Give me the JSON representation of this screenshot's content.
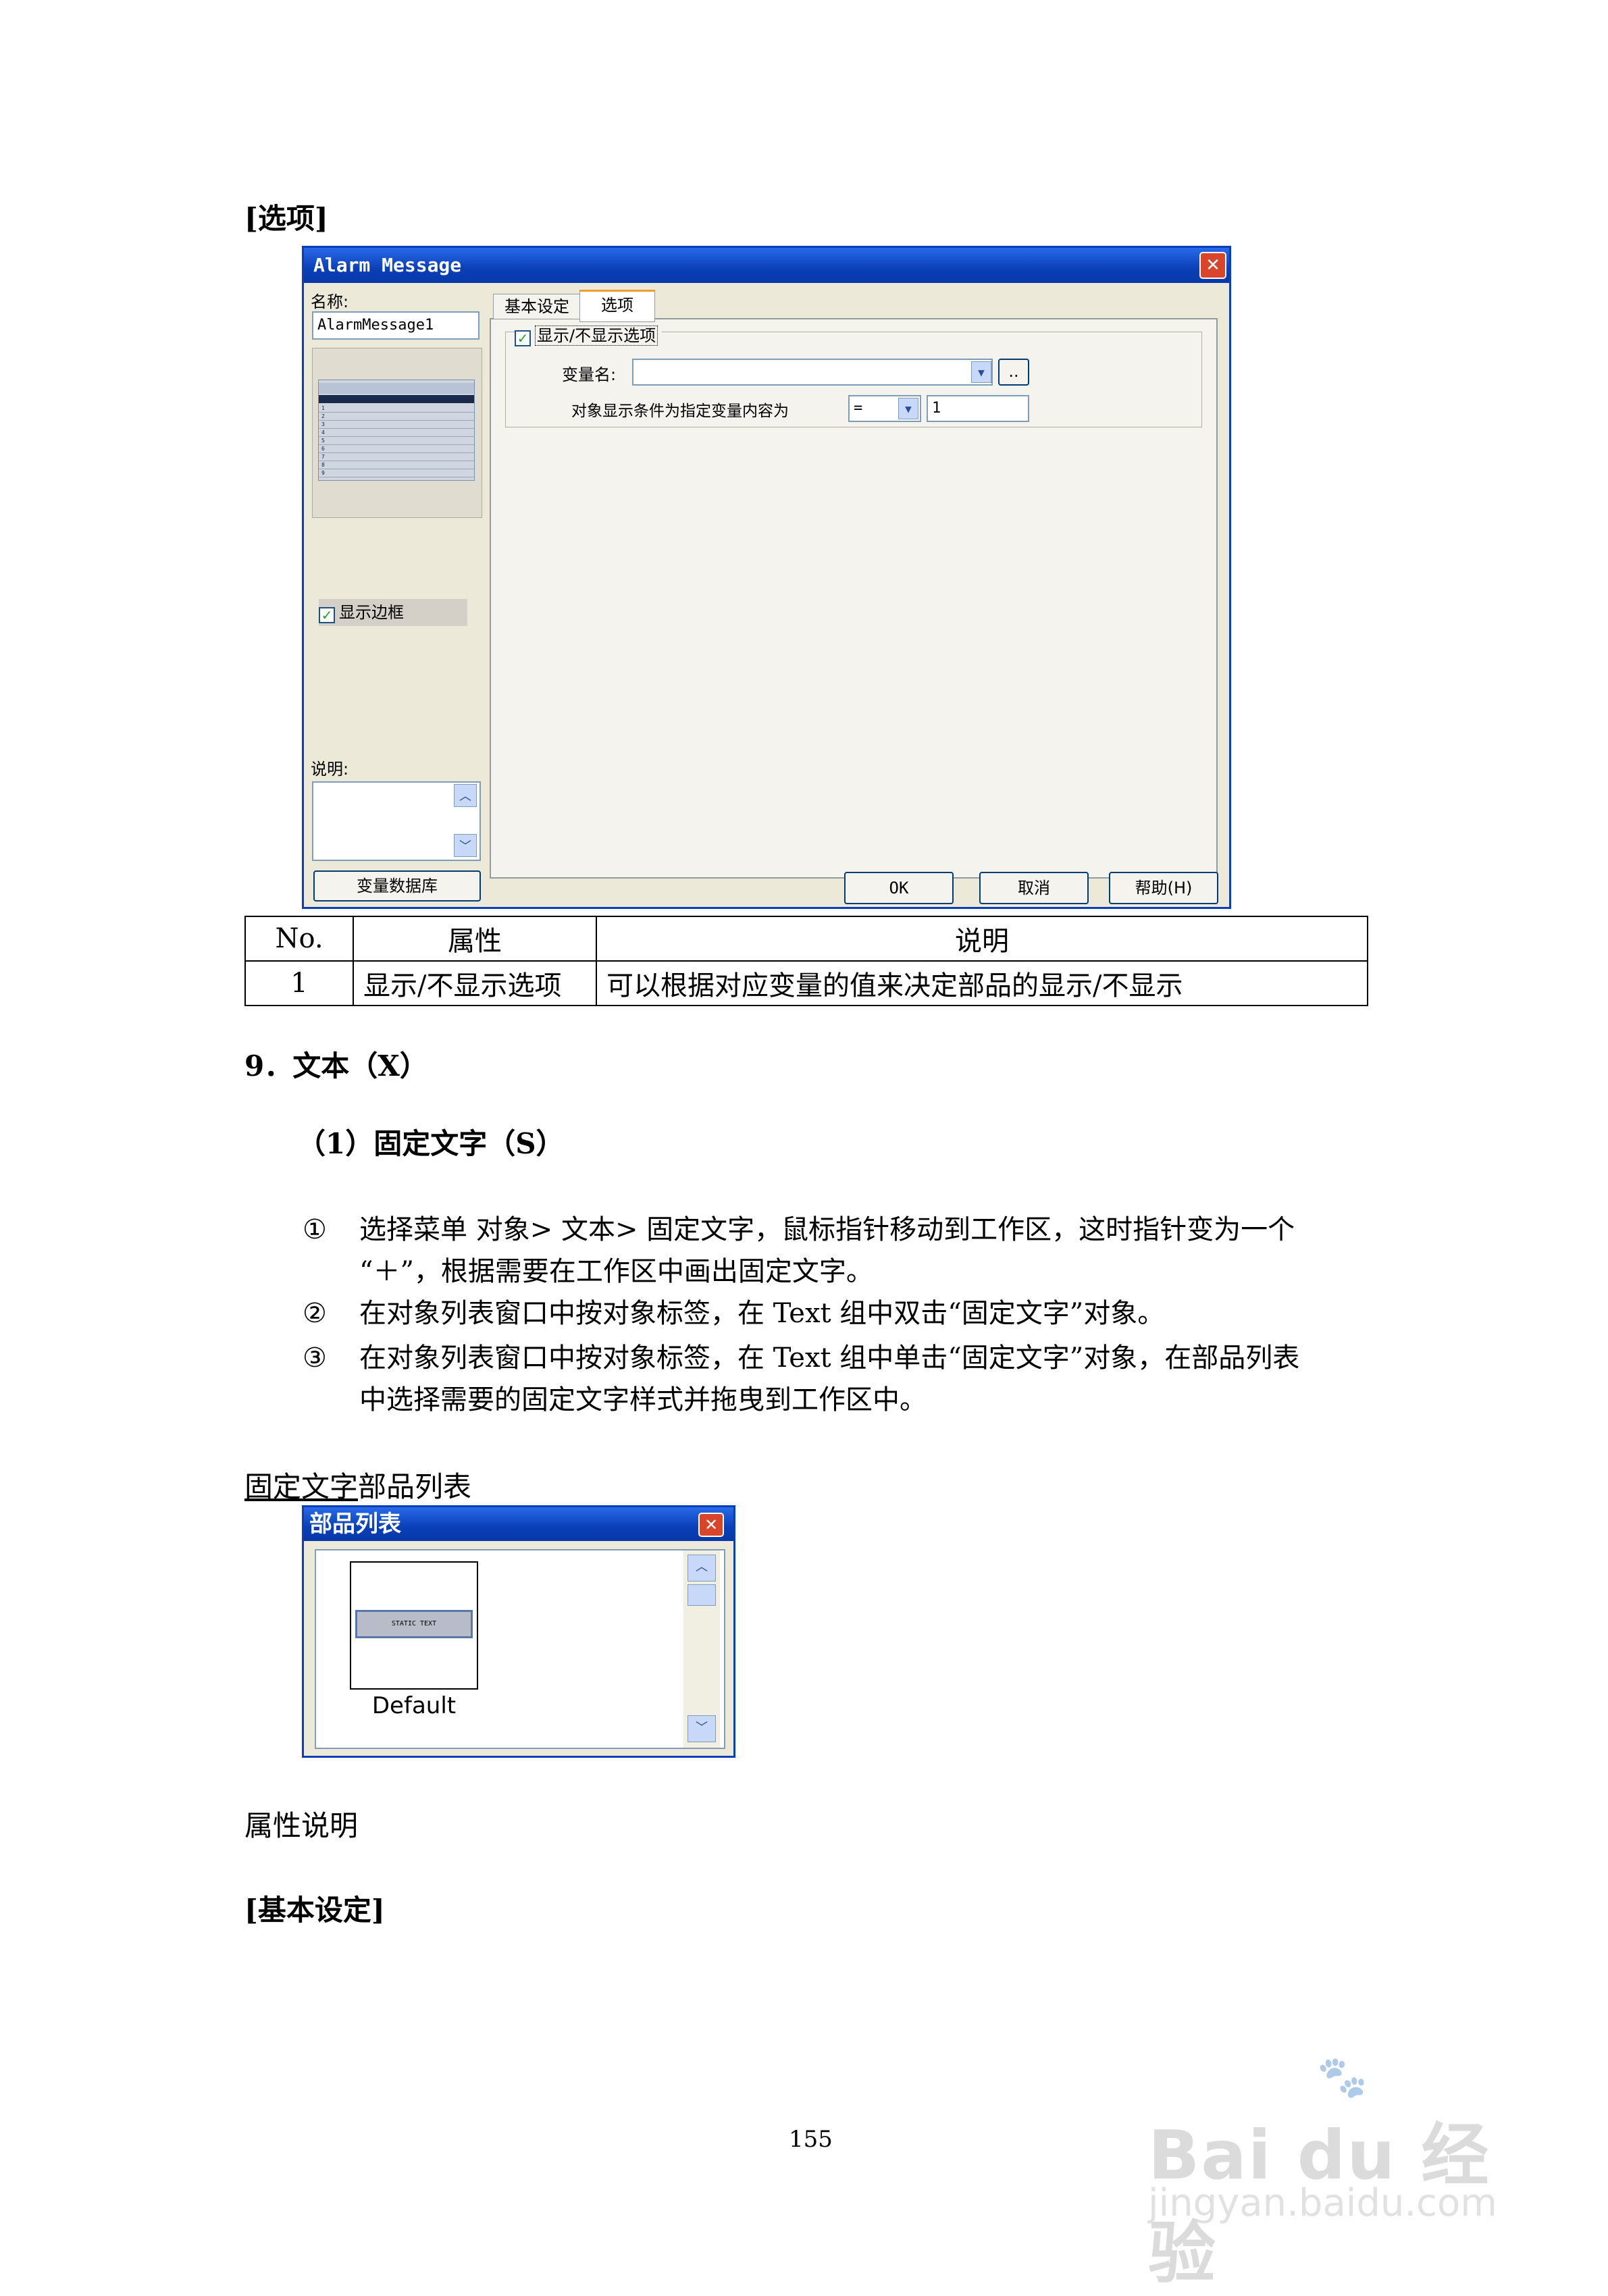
{
  "sections": {
    "options_heading": "[选项]",
    "text_heading": "9．文本（X）",
    "fixed_text_heading": "（1）固定文字（S）",
    "parts_list_label_u": "固定文字",
    "parts_list_label_rest": "部品列表",
    "attr_desc": "属性说明",
    "basic_setting": "[基本设定]"
  },
  "dialog": {
    "title": "Alarm Message",
    "name_label": "名称:",
    "name_value": "AlarmMessage1",
    "tab_basic": "基本设定",
    "tab_options": "选项",
    "show_option_check": "显示/不显示选项",
    "var_name_label": "变量名:",
    "var_browse": "..",
    "condition_label": "对象显示条件为指定变量内容为",
    "operator_value": "=",
    "condition_value": "1",
    "show_border_check": "显示边框",
    "desc_label": "说明:",
    "var_db_button": "变量数据库",
    "ok_button": "OK",
    "cancel_button": "取消",
    "help_button": "帮助(H)",
    "preview_rows": [
      "1",
      "2",
      "3",
      "4",
      "5",
      "6",
      "7",
      "8",
      "9"
    ]
  },
  "table": {
    "headers": [
      "No.",
      "属性",
      "说明"
    ],
    "rows": [
      [
        "1",
        "显示/不显示选项",
        "可以根据对应变量的值来决定部品的显示/不显示"
      ]
    ]
  },
  "steps": [
    {
      "num": "①",
      "line1": "选择菜单  对象>  文本>  固定文字，鼠标指针移动到工作区，这时指针变为一个",
      "line2": "“＋”，根据需要在工作区中画出固定文字。"
    },
    {
      "num": "②",
      "line1": "在对象列表窗口中按对象标签，在 Text 组中双击“固定文字”对象。",
      "line2": ""
    },
    {
      "num": "③",
      "line1": "在对象列表窗口中按对象标签，在 Text 组中单击“固定文字”对象，在部品列表",
      "line2": "中选择需要的固定文字样式并拖曳到工作区中。"
    }
  ],
  "parts_window": {
    "title": "部品列表",
    "item_text": "STATIC TEXT",
    "item_label": "Default"
  },
  "page_number": "155",
  "watermark": {
    "brand": "Bai du 经验",
    "url": "jingyan.baidu.com"
  }
}
